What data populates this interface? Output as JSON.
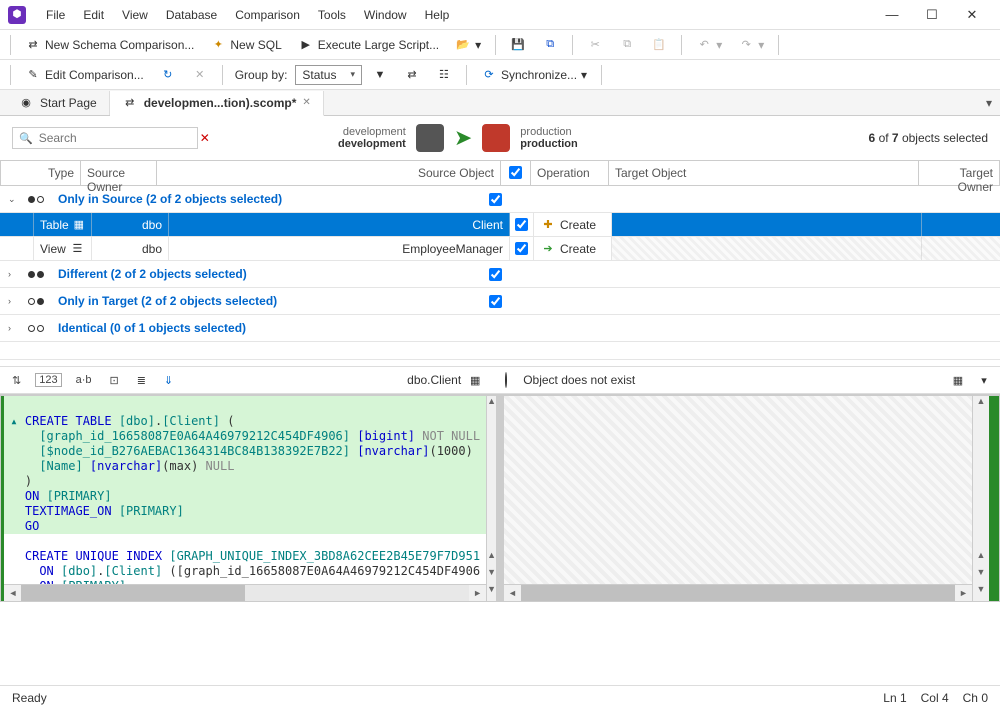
{
  "menu": {
    "file": "File",
    "edit": "Edit",
    "view": "View",
    "database": "Database",
    "comparison": "Comparison",
    "tools": "Tools",
    "window": "Window",
    "help": "Help"
  },
  "toolbar1": {
    "newcomp": "New Schema Comparison...",
    "newsql": "New SQL",
    "exec": "Execute Large Script..."
  },
  "toolbar2": {
    "editcomp": "Edit Comparison...",
    "groupby_label": "Group by:",
    "groupby_value": "Status",
    "sync": "Synchronize..."
  },
  "tabs": {
    "start": "Start Page",
    "active": "developmen...tion).scomp*"
  },
  "search": {
    "placeholder": "Search"
  },
  "dbs": {
    "src1": "development",
    "src2": "development",
    "tgt1": "production",
    "tgt2": "production"
  },
  "selinfo": {
    "count_bold": "6",
    "of": " of ",
    "total": "7",
    "rest": " objects selected"
  },
  "cols": {
    "type": "Type",
    "sowner": "Source Owner",
    "sobj": "Source Object",
    "op": "Operation",
    "tobj": "Target Object",
    "towner": "Target Owner"
  },
  "groups": {
    "src": "Only in Source (2 of 2 objects selected)",
    "diff": "Different (2 of 2 objects selected)",
    "tgt": "Only in Target (2 of 2 objects selected)",
    "ident": "Identical (0 of 1 objects selected)"
  },
  "rows": [
    {
      "type": "Table",
      "owner": "dbo",
      "obj": "Client",
      "op": "Create"
    },
    {
      "type": "View",
      "owner": "dbo",
      "obj": "EmployeeManager",
      "op": "Create"
    }
  ],
  "sub": {
    "srcobj": "dbo.Client",
    "noexist": "Object does not exist"
  },
  "code": {
    "l1a": "CREATE TABLE",
    "l1b": "[dbo]",
    "l1c": "[Client]",
    "l2a": "[graph_id_16658087E0A64A46979212C454DF4906]",
    "l2b": "[bigint]",
    "l2c": "NOT NULL",
    "l3a": "[$node_id_B276AEBAC1364314BC84B138392E7B22]",
    "l3b": "[nvarchar]",
    "l3c": "(1000)",
    "l4a": "[Name]",
    "l4b": "[nvarchar]",
    "l4c": "(max)",
    "l4d": "NULL",
    "l5": ")",
    "l6a": "ON",
    "l6b": "[PRIMARY]",
    "l7": "TEXTIMAGE_ON",
    "l7b": "[PRIMARY]",
    "l8": "GO",
    "l9a": "CREATE UNIQUE INDEX",
    "l9b": "[GRAPH_UNIQUE_INDEX_3BD8A62CEE2B45E79F7D951",
    "l10a": "ON",
    "l10b": "[dbo]",
    "l10c": "[Client]",
    "l10d": "([graph_id_16658087E0A64A46979212C454DF4906",
    "l11a": "ON",
    "l11b": "[PRIMARY]"
  },
  "status": {
    "ready": "Ready",
    "ln": "Ln 1",
    "col": "Col 4",
    "ch": "Ch 0"
  }
}
